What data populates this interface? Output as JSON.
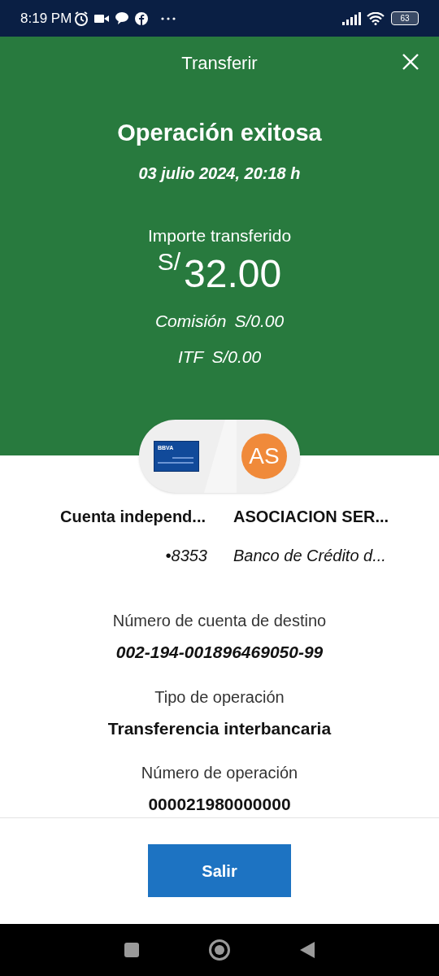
{
  "status_bar": {
    "time": "8:19 PM",
    "battery": "63"
  },
  "header": {
    "title": "Transferir"
  },
  "result": {
    "title": "Operación exitosa",
    "date": "03 julio 2024, 20:18 h",
    "amount_label": "Importe transferido",
    "currency": "S/",
    "amount": "32.00",
    "fees": [
      {
        "label": "Comisión",
        "value": "S/0.00"
      },
      {
        "label": "ITF",
        "value": "S/0.00"
      }
    ]
  },
  "origin": {
    "card_brand": "BBVA",
    "name": "Cuenta independ...",
    "number": "•8353"
  },
  "destination": {
    "initials": "AS",
    "name": "ASOCIACION SER...",
    "bank": "Banco de Crédito d..."
  },
  "details": [
    {
      "label": "Número de cuenta de destino",
      "value": "002-194-001896469050-99",
      "italic": true
    },
    {
      "label": "Tipo de operación",
      "value": "Transferencia interbancaria",
      "italic": false
    },
    {
      "label": "Número de operación",
      "value": "000021980000000",
      "italic": false
    }
  ],
  "footer": {
    "button": "Salir"
  }
}
